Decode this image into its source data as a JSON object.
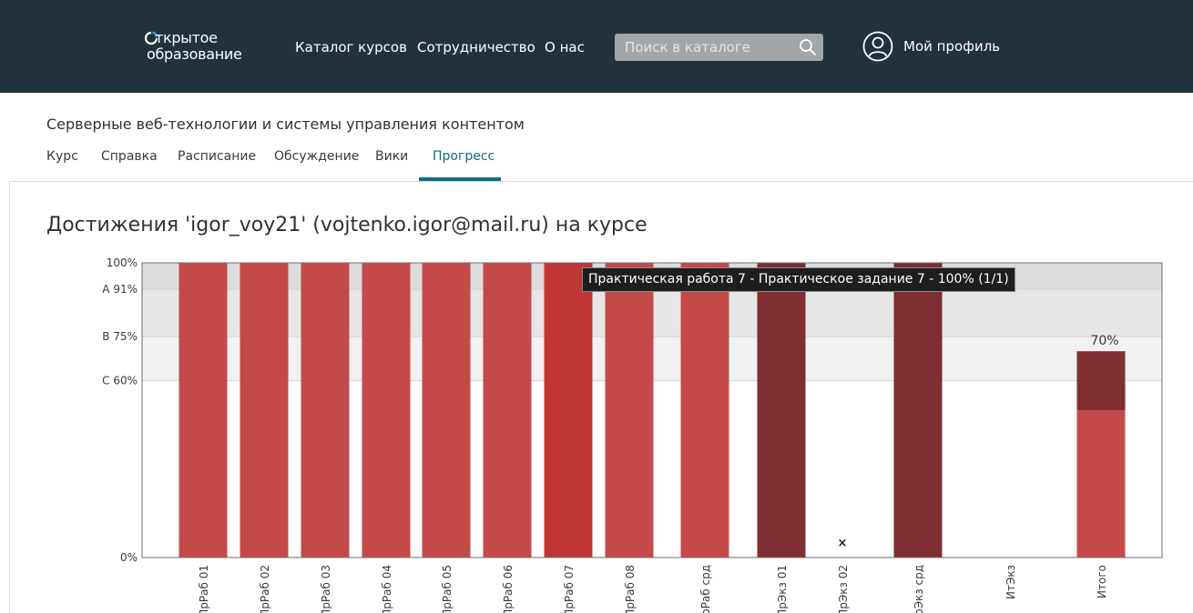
{
  "header": {
    "logo_line1": "ткрытое",
    "logo_line2": "образование",
    "nav": [
      "Каталог курсов",
      "Сотрудничество",
      "О нас"
    ],
    "search_placeholder": "Поиск в каталоге",
    "profile_label": "Мой профиль"
  },
  "course": {
    "title": "Серверные веб-технологии и системы управления контентом",
    "tabs": [
      "Курс",
      "Справка",
      "Расписание",
      "Обсуждение",
      "Вики",
      "Прогресс"
    ],
    "active_tab": "Прогресс"
  },
  "page": {
    "heading": "Достижения 'igor_voy21' (vojtenko.igor@mail.ru) на курсе"
  },
  "tooltip": "Практическая работа 7 - Практическое задание 7 - 100% (1/1)",
  "colors": {
    "header_bg": "#22323d",
    "bar": "#c44a4a",
    "bar_highlight": "#bf3536",
    "bar_dark": "#7f2e31",
    "accent": "#0f6b87"
  },
  "chart_data": {
    "type": "bar",
    "ylim": [
      0,
      100
    ],
    "y_ticks": [
      {
        "label": "100%",
        "value": 100
      },
      {
        "label": "A 91%",
        "value": 91
      },
      {
        "label": "B 75%",
        "value": 75
      },
      {
        "label": "C 60%",
        "value": 60
      },
      {
        "label": "0%",
        "value": 0
      }
    ],
    "grade_bands": [
      {
        "from": 91,
        "to": 100,
        "color": "#dcdcdc"
      },
      {
        "from": 75,
        "to": 91,
        "color": "#e6e6e6"
      },
      {
        "from": 60,
        "to": 75,
        "color": "#f1f1f1"
      }
    ],
    "categories": [
      "ПрРаб 01",
      "ПрРаб 02",
      "ПрРаб 03",
      "ПрРаб 04",
      "ПрРаб 05",
      "ПрРаб 06",
      "ПрРаб 07",
      "ПрРаб 08",
      "ПрРаб срд",
      "ПрЭкз 01",
      "ПрЭкз 02",
      "ПрЭкз срд",
      "ИтЭкз",
      "Итого"
    ],
    "values": [
      100,
      100,
      100,
      100,
      100,
      100,
      100,
      100,
      100,
      100,
      0,
      100,
      null,
      70
    ],
    "styles": [
      "normal",
      "normal",
      "normal",
      "normal",
      "normal",
      "normal",
      "highlight",
      "normal",
      "normal",
      "dark",
      "dropped",
      "dark",
      "none",
      "total"
    ],
    "total": {
      "value": 70,
      "label": "70%",
      "lower_part": 50,
      "upper_part": 20
    },
    "dropped_marker": "×",
    "grid": false
  }
}
